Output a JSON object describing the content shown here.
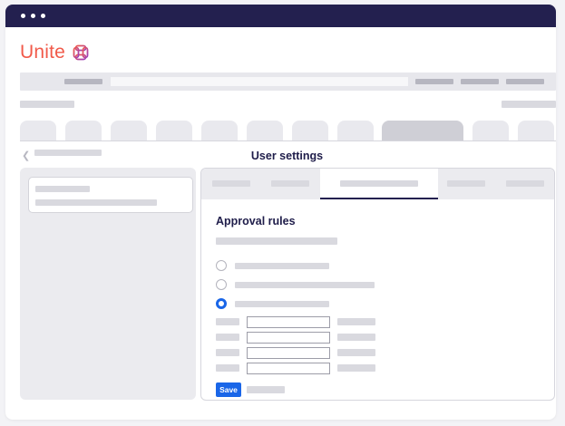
{
  "window": {
    "traffic_lights": 3
  },
  "brand": {
    "name": "Unite",
    "color": "#f15a4a",
    "mark_icon": "unite-knot-logo"
  },
  "page": {
    "title": "User settings"
  },
  "settings": {
    "section_title": "Approval rules",
    "options": [
      {
        "checked": false
      },
      {
        "checked": false
      },
      {
        "checked": true
      }
    ],
    "fields": [
      {
        "value": ""
      },
      {
        "value": ""
      },
      {
        "value": ""
      },
      {
        "value": ""
      }
    ],
    "save_label": "Save"
  },
  "colors": {
    "titlebar": "#23204f",
    "accent": "#1a66e8",
    "text": "#1f1d4a",
    "placeholder_bar": "#d9d9df"
  }
}
